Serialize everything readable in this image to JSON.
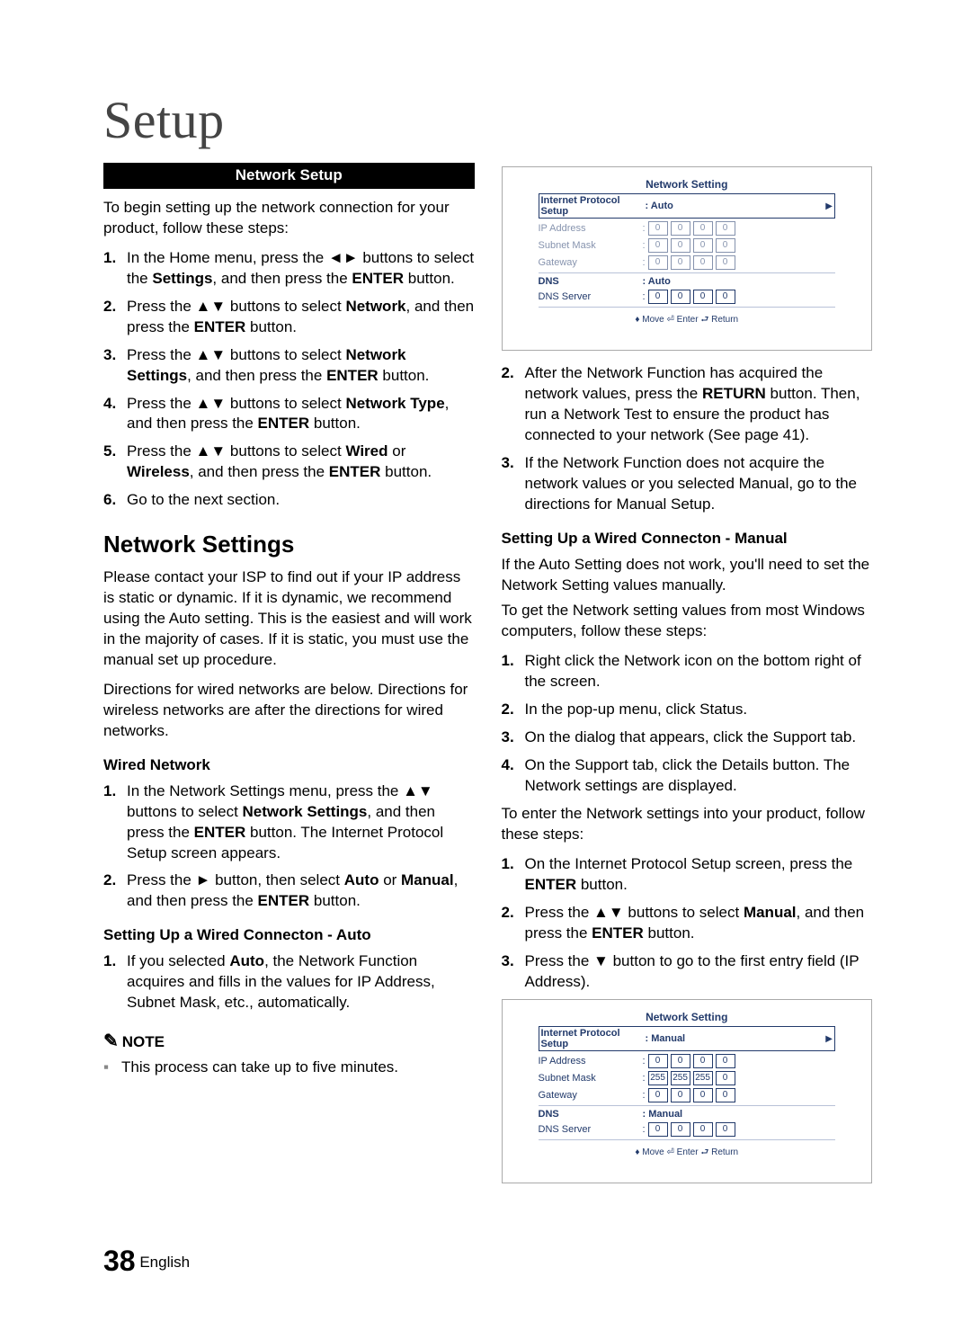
{
  "title": "Setup",
  "sectionBar": "Network Setup",
  "intro": "To begin setting up the network connection for your product, follow these steps:",
  "leftSteps": [
    "In the Home menu, press the ◄► buttons to select the <b>Settings</b>, and then press the <b>ENTER</b> button.",
    "Press the ▲▼ buttons to select <b>Network</b>, and then press the <b>ENTER</b> button.",
    "Press the ▲▼ buttons to select <b>Network Settings</b>, and then press the <b>ENTER</b> button.",
    "Press the ▲▼ buttons to select <b>Network Type</b>, and then press the <b>ENTER</b> button.",
    "Press the ▲▼ buttons to select <b>Wired</b> or <b>Wireless</b>, and then press the <b>ENTER</b> button.",
    "Go to the next section."
  ],
  "h2": "Network Settings",
  "nsPara1": "Please contact your ISP to find out if your IP address is static or dynamic. If it is dynamic, we recommend using the Auto setting. This is the easiest and will work in the majority of cases. If it is static, you must use the manual set up procedure.",
  "nsPara2": "Directions for wired networks are below. Directions for wireless networks are after the directions for wired networks.",
  "wiredH3": "Wired Network",
  "wiredSteps": [
    "In the Network Settings menu, press the ▲▼ buttons to select <b>Network Settings</b>, and then press the <b>ENTER</b> button. The Internet Protocol Setup screen appears.",
    "Press the ► button, then select <b>Auto</b> or <b>Manual</b>, and then press the <b>ENTER</b> button."
  ],
  "autoH3": "Setting Up a Wired Connecton - Auto",
  "autoSteps": [
    "If you selected <b>Auto</b>, the Network Function acquires and fills in the values for IP Address, Subnet Mask, etc., automatically."
  ],
  "noteLabel": "NOTE",
  "noteItem": "This process can take up to five minutes.",
  "rightSteps1": [
    "After the Network Function has acquired the network values, press the <b>RETURN</b> button. Then, run a Network Test to ensure the product has connected to your network (See page 41).",
    "If the Network Function does not acquire the network values or you selected Manual, go to the directions for Manual Setup."
  ],
  "rightSteps1StartNum": 2,
  "manualH3": "Setting Up a Wired Connecton - Manual",
  "manualIntro1": "If the Auto Setting does not work, you'll need to set the Network Setting values manually.",
  "manualIntro2": "To get the Network setting values from most Windows computers, follow these steps:",
  "manualSteps1": [
    "Right click the Network icon on the bottom right of the screen.",
    "In the pop-up menu, click Status.",
    "On the dialog that appears, click the Support tab.",
    "On the Support tab, click the Details button. The Network settings are displayed."
  ],
  "manualIntro3": "To enter the Network settings into your product, follow these steps:",
  "manualSteps2": [
    "On the Internet Protocol Setup screen, press the <b>ENTER</b> button.",
    "Press the ▲▼ buttons to select <b>Manual</b>, and then press the <b>ENTER</b> button.",
    "Press the ▼ button to go to the first entry field (IP Address)."
  ],
  "osd1": {
    "title": "Network Setting",
    "ipSetupLabel": "Internet Protocol Setup",
    "ipSetupValue": ": Auto",
    "rows": [
      {
        "label": "IP Address",
        "v": [
          "0",
          "0",
          "0",
          "0"
        ],
        "dim": true
      },
      {
        "label": "Subnet Mask",
        "v": [
          "0",
          "0",
          "0",
          "0"
        ],
        "dim": true
      },
      {
        "label": "Gateway",
        "v": [
          "0",
          "0",
          "0",
          "0"
        ],
        "dim": true
      }
    ],
    "dnsLabel": "DNS",
    "dnsValue": ": Auto",
    "dnsServerLabel": "DNS Server",
    "dnsServer": [
      "0",
      "0",
      "0",
      "0"
    ],
    "footer": "♦ Move    ⏎ Enter    ⮐ Return"
  },
  "osd2": {
    "title": "Network Setting",
    "ipSetupLabel": "Internet Protocol Setup",
    "ipSetupValue": ": Manual",
    "rows": [
      {
        "label": "IP Address",
        "v": [
          "0",
          "0",
          "0",
          "0"
        ]
      },
      {
        "label": "Subnet Mask",
        "v": [
          "255",
          "255",
          "255",
          "0"
        ]
      },
      {
        "label": "Gateway",
        "v": [
          "0",
          "0",
          "0",
          "0"
        ]
      }
    ],
    "dnsLabel": "DNS",
    "dnsValue": ": Manual",
    "dnsServerLabel": "DNS Server",
    "dnsServer": [
      "0",
      "0",
      "0",
      "0"
    ],
    "footer": "♦ Move    ⏎ Enter    ⮐ Return"
  },
  "footer": {
    "pageNum": "38",
    "lang": "English"
  }
}
